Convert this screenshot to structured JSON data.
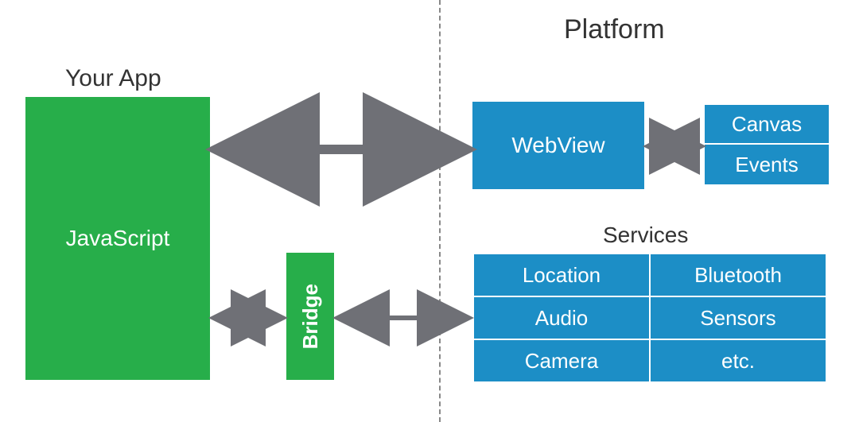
{
  "colors": {
    "green": "#27ae4a",
    "blue": "#1c8ec6",
    "arrow": "#6f7076",
    "text": "#333333"
  },
  "left": {
    "title": "Your App",
    "app_box": "JavaScript",
    "bridge_box": "Bridge"
  },
  "right": {
    "title": "Platform",
    "webview": "WebView",
    "webview_side": [
      "Canvas",
      "Events"
    ],
    "services_title": "Services",
    "services_rows": [
      [
        "Location",
        "Bluetooth"
      ],
      [
        "Audio",
        "Sensors"
      ],
      [
        "Camera",
        "etc."
      ]
    ]
  }
}
